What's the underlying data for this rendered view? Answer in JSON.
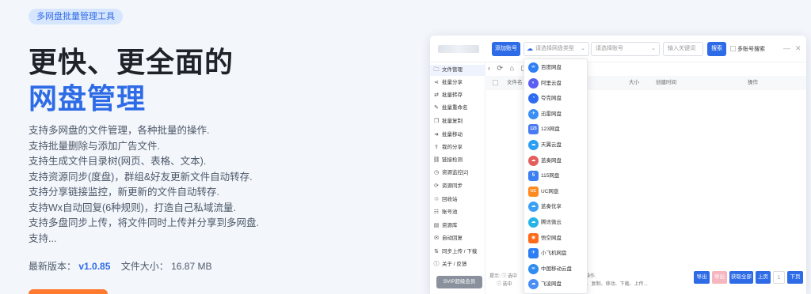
{
  "hero": {
    "badge": "多网盘批量管理工具",
    "title_line1": "更快、更全面的",
    "title_line2": "网盘管理",
    "features": [
      "支持多网盘的文件管理，各种批量的操作.",
      "支持批量删除与添加广告文件.",
      "支持生成文件目录树(网页、表格、文本).",
      "支持资源同步(度盘)，群组&好友更新文件自动转存.",
      "支持分享链接监控，新更新的文件自动转存.",
      "支持Wx自动回复(6种规则)，打造自己私域流量.",
      "支持多盘同步上传，将文件同时上传并分享到多网盘.",
      "支持..."
    ],
    "version_label": "最新版本：",
    "version": "v1.0.85",
    "size_label": "文件大小：",
    "size": "16.87 MB"
  },
  "app": {
    "toolbar": {
      "add_account": "添加账号",
      "drive_type_placeholder": "请选择网盘类型",
      "account_placeholder": "请选择账号",
      "keyword_placeholder": "输入关键词",
      "search": "搜索",
      "multi_search": "多账号搜索",
      "minimize": "—",
      "close": "✕"
    },
    "sidebar": [
      {
        "label": "文件管理",
        "icon": "folder-icon",
        "glyph": "🗀"
      },
      {
        "label": "批量分享",
        "icon": "share-icon",
        "glyph": "⋖"
      },
      {
        "label": "批量转存",
        "icon": "transfer-icon",
        "glyph": "⇄"
      },
      {
        "label": "批量重命名",
        "icon": "rename-icon",
        "glyph": "✎"
      },
      {
        "label": "批量复制",
        "icon": "copy-icon",
        "glyph": "❐"
      },
      {
        "label": "批量移动",
        "icon": "move-icon",
        "glyph": "➜"
      },
      {
        "label": "我的分享",
        "icon": "my-share-icon",
        "glyph": "⇪"
      },
      {
        "label": "链接检测",
        "icon": "link-check-icon",
        "glyph": "⛓"
      },
      {
        "label": "资源监控[2]",
        "icon": "monitor-icon",
        "glyph": "◷"
      },
      {
        "label": "资源同步",
        "icon": "sync-icon",
        "glyph": "⟳"
      },
      {
        "label": "回收站",
        "icon": "recycle-icon",
        "glyph": "♲"
      },
      {
        "label": "账号池",
        "icon": "account-pool-icon",
        "glyph": "☷"
      },
      {
        "label": "资源库",
        "icon": "library-icon",
        "glyph": "▤"
      },
      {
        "label": "自动回复",
        "icon": "auto-reply-icon",
        "glyph": "✉"
      },
      {
        "label": "同步上传 / 下载",
        "icon": "upload-download-icon",
        "glyph": "⇅"
      },
      {
        "label": "关于 / 反馈",
        "icon": "about-icon",
        "glyph": "ⓘ"
      }
    ],
    "svip": "SVIP超级会员",
    "nav_icons": "‹ ⟳ ⌂ ▢",
    "table_headers": {
      "name": "文件名",
      "size": "大小",
      "created": "创建时间",
      "action": "操作"
    },
    "footer": {
      "line1_prefix": "提示: ⓘ 选中",
      "line1_suffix": "批操作.",
      "line2_prefix": "ⓘ 选中",
      "line2_suffix": "量分享、复制、移动、下载、上传..."
    },
    "pager": {
      "export": "导出",
      "blank": "导出",
      "get_all": "获取全部",
      "prev": "上页",
      "page": "1",
      "next": "下页"
    },
    "dropdown": [
      {
        "label": "百度网盘",
        "icon": "baidu-pan-icon",
        "glyph": "∞",
        "color": "#2e7ff5"
      },
      {
        "label": "阿里云盘",
        "icon": "aliyun-pan-icon",
        "glyph": "◐",
        "color": "#5b5ef3"
      },
      {
        "label": "夸克网盘",
        "icon": "quark-pan-icon",
        "glyph": "◔",
        "color": "#2f6bf0"
      },
      {
        "label": "迅雷网盘",
        "icon": "xunlei-pan-icon",
        "glyph": "✈",
        "color": "#3a8ef6"
      },
      {
        "label": "123网盘",
        "icon": "123-pan-icon",
        "glyph": "123",
        "color": "#4a7bf2"
      },
      {
        "label": "天翼云盘",
        "icon": "tianyi-pan-icon",
        "glyph": "☁",
        "color": "#2a9df4"
      },
      {
        "label": "蓝奏网盘",
        "icon": "lanzou-pan-icon",
        "glyph": "☁",
        "color": "#e35d5d"
      },
      {
        "label": "115网盘",
        "icon": "115-pan-icon",
        "glyph": "5",
        "color": "#3b7ff0"
      },
      {
        "label": "UC网盘",
        "icon": "uc-pan-icon",
        "glyph": "UC",
        "color": "#ff8a1f"
      },
      {
        "label": "蓝奏优享",
        "icon": "lanzou-youxiang-icon",
        "glyph": "☁",
        "color": "#3aa0f5"
      },
      {
        "label": "腾讯微云",
        "icon": "weiyun-icon",
        "glyph": "☁",
        "color": "#25b3e8"
      },
      {
        "label": "悟空网盘",
        "icon": "wukong-pan-icon",
        "glyph": "◉",
        "color": "#ff6a1a"
      },
      {
        "label": "小飞机网盘",
        "icon": "feiji-pan-icon",
        "glyph": "✈",
        "color": "#2d7ef4"
      },
      {
        "label": "中国移动云盘",
        "icon": "mobile-cloud-icon",
        "glyph": "∞",
        "color": "#2e8bf0"
      },
      {
        "label": "飞凌网盘",
        "icon": "feiling-pan-icon",
        "glyph": "☁",
        "color": "#4b8df8"
      }
    ]
  }
}
